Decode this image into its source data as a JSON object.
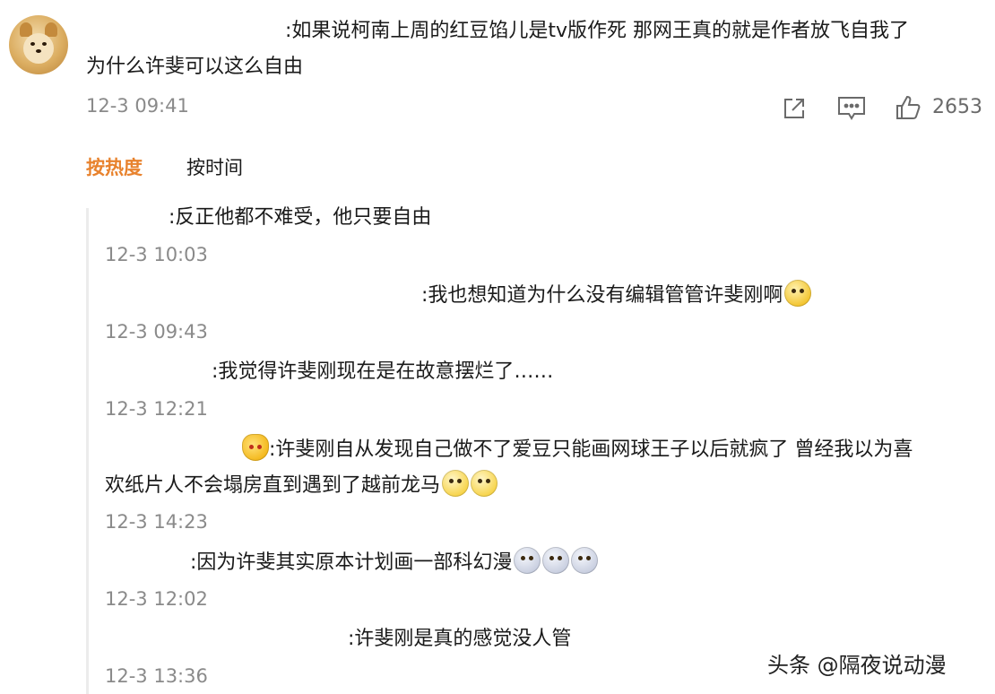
{
  "post": {
    "text_line1": ":如果说柯南上周的红豆馅儿是tv版作死 那网王真的就是作者放飞自我了",
    "text_line2": "为什么许斐可以这么自由",
    "time": "12-3 09:41",
    "share_icon": "share-icon",
    "comment_icon": "comment-icon",
    "like_icon": "thumbs-up-icon",
    "like_count": "2653"
  },
  "tabs": {
    "hot": "按热度",
    "time": "按时间"
  },
  "replies": [
    {
      "text": ":反正他都不难受，他只要自由",
      "time": "12-3 10:03"
    },
    {
      "text": ":我也想知道为什么没有编辑管管许斐刚啊",
      "time": "12-3 09:43"
    },
    {
      "text": ":我觉得许斐刚现在是在故意摆烂了……",
      "time": "12-3 12:21"
    },
    {
      "text_line1": ":许斐刚自从发现自己做不了爱豆只能画网球王子以后就疯了 曾经我以为喜",
      "text_line2": "欢纸片人不会塌房直到遇到了越前龙马",
      "time": "12-3 14:23"
    },
    {
      "text": ":因为许斐其实原本计划画一部科幻漫",
      "time": "12-3 12:02"
    },
    {
      "text": ":许斐刚是真的感觉没人管",
      "time": "12-3 13:36"
    }
  ],
  "watermark": "头条 @隔夜说动漫",
  "colors": {
    "accent": "#e8822d",
    "time_gray": "#8a8a8a"
  }
}
